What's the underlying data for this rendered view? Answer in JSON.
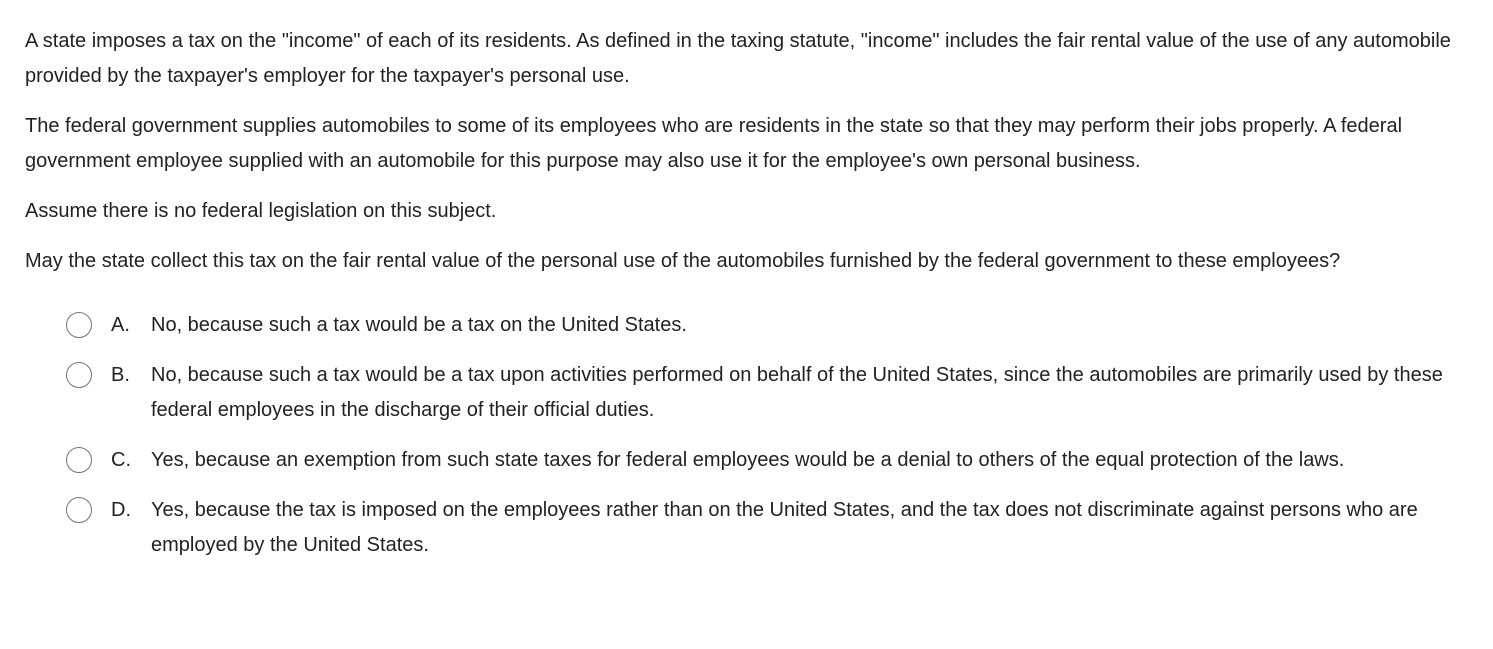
{
  "question": {
    "paragraphs": [
      "A state imposes a tax on the \"income\" of each of its residents.  As defined in the taxing statute, \"income\" includes the fair rental value of the use of any automobile provided by the taxpayer's employer for the taxpayer's personal use.",
      "The federal government supplies automobiles to some of its employees who are residents in the state so that they may perform their jobs properly.  A federal government employee supplied with an automobile for this purpose may also use it for the employee's own personal business.",
      "Assume there is no federal legislation on this subject.",
      "May the state collect this tax on the fair rental value of the personal use of the automobiles furnished by the federal government to these employees?"
    ]
  },
  "choices": [
    {
      "letter": "A.",
      "text": "No, because such a tax would be a tax on the United States.",
      "selected": false
    },
    {
      "letter": "B.",
      "text": "No, because such a tax would be a tax upon activities performed on behalf of the United States, since the automobiles are primarily used by these federal employees in the discharge of their official duties.",
      "selected": false
    },
    {
      "letter": "C.",
      "text": "Yes, because an exemption from such state taxes for federal employees would be a denial to others of the equal protection of the laws.",
      "selected": false
    },
    {
      "letter": "D.",
      "text": "Yes, because the tax is imposed on the employees rather than on the United States, and the tax does not discriminate against persons who are employed by the United States.",
      "selected": false
    }
  ]
}
